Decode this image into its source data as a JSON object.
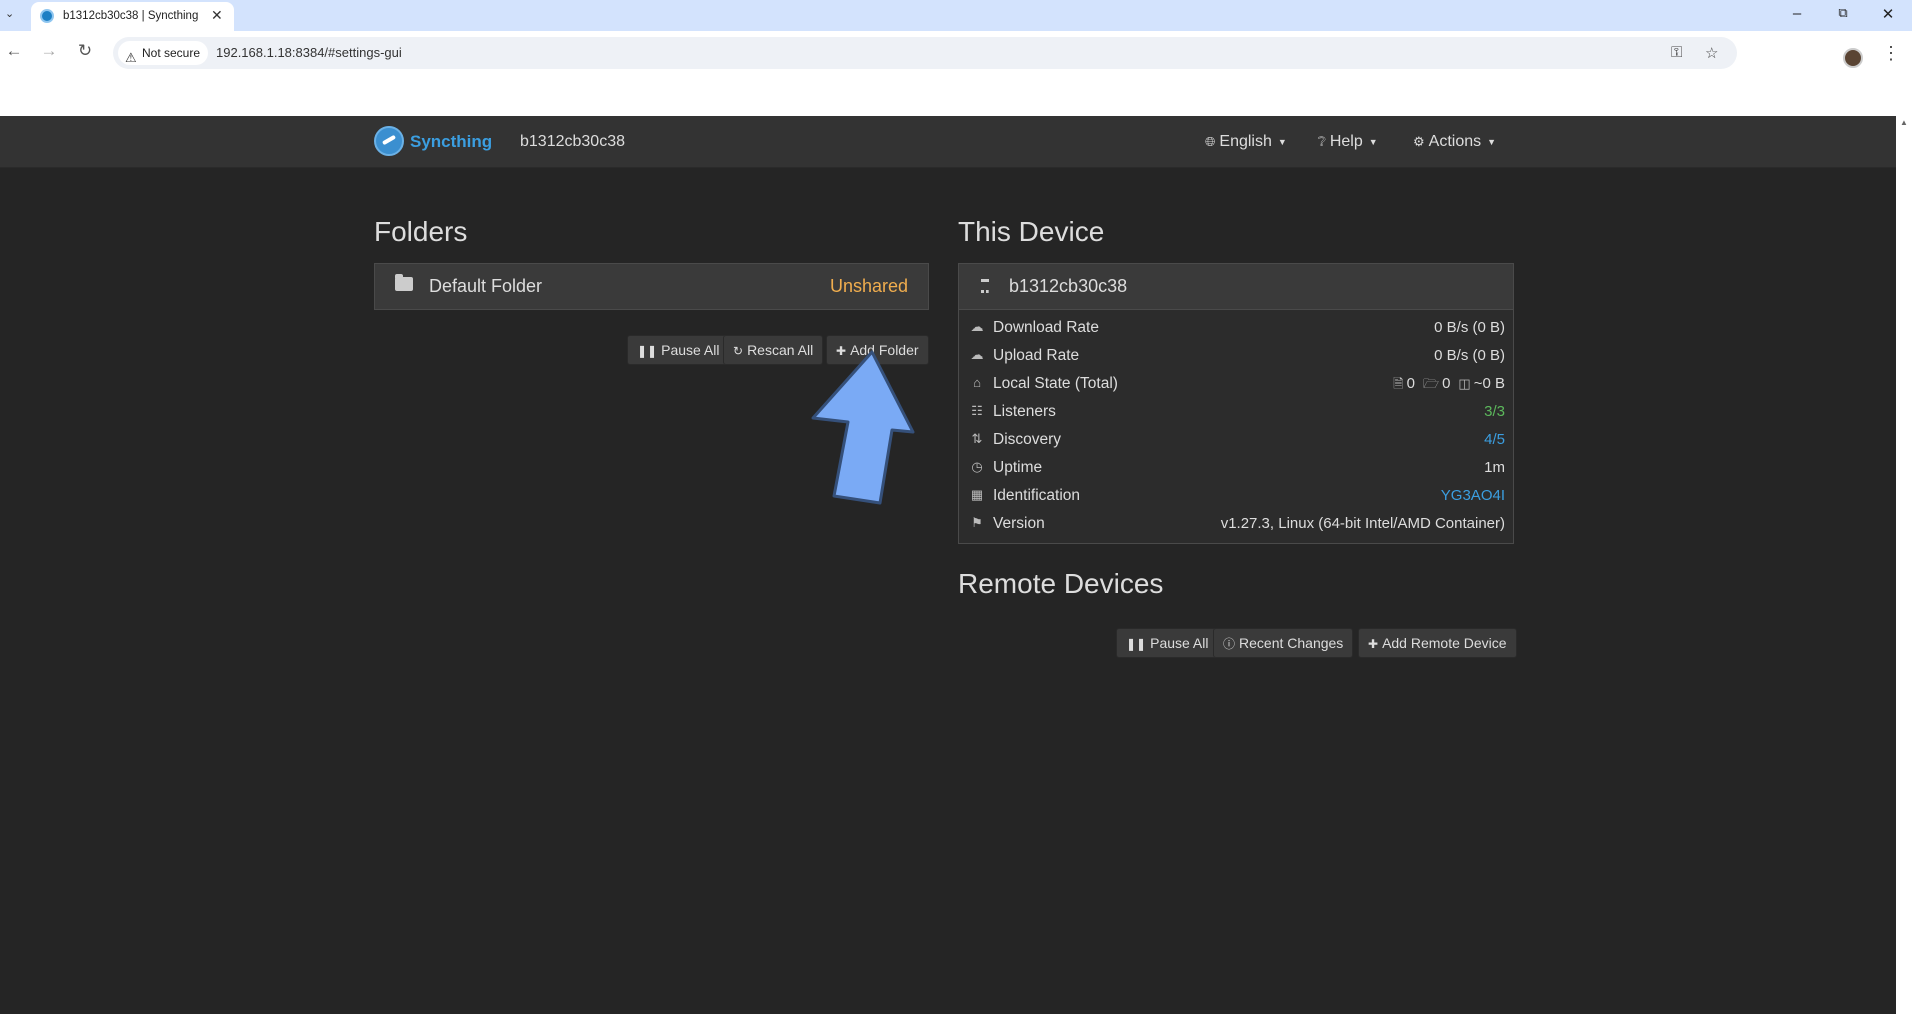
{
  "browser": {
    "tab_title": "b1312cb30c38 | Syncthing",
    "tab_close": "✕",
    "not_secure": "Not secure",
    "url": "192.168.1.18:8384/#settings-gui"
  },
  "app": {
    "brand": "Syncthing",
    "device_name": "b1312cb30c38",
    "menus": {
      "language": "English",
      "help": "Help",
      "actions": "Actions"
    }
  },
  "folders": {
    "title": "Folders",
    "items": [
      {
        "label": "Default Folder",
        "status": "Unshared"
      }
    ],
    "buttons": {
      "pause_all": "Pause All",
      "rescan_all": "Rescan All",
      "add_folder": "Add Folder"
    }
  },
  "this_device": {
    "title": "This Device",
    "name": "b1312cb30c38",
    "stats": [
      {
        "icon": "cloud-download-icon",
        "label": "Download Rate",
        "value": "0 B/s (0 B)"
      },
      {
        "icon": "cloud-upload-icon",
        "label": "Upload Rate",
        "value": "0 B/s (0 B)"
      },
      {
        "icon": "home-icon",
        "label": "Local State (Total)",
        "files": "0",
        "dirs": "0",
        "size": "~0 B"
      },
      {
        "icon": "sitemap-icon",
        "label": "Listeners",
        "value": "3/3",
        "color": "#5cb85c"
      },
      {
        "icon": "signpost-icon",
        "label": "Discovery",
        "value": "4/5",
        "color": "#3b9ee0"
      },
      {
        "icon": "clock-icon",
        "label": "Uptime",
        "value": "1m"
      },
      {
        "icon": "qrcode-icon",
        "label": "Identification",
        "value": "YG3AO4I",
        "color": "#3b9ee0"
      },
      {
        "icon": "tag-icon",
        "label": "Version",
        "value": "v1.27.3, Linux (64-bit Intel/AMD Container)"
      }
    ]
  },
  "remote_devices": {
    "title": "Remote Devices",
    "buttons": {
      "pause_all": "Pause All",
      "recent_changes": "Recent Changes",
      "add_remote_device": "Add Remote Device"
    }
  },
  "colors": {
    "background": "#252525",
    "navbar": "#333333",
    "accent": "#3b9ee0",
    "warning": "#f0ad4e",
    "success": "#5cb85c",
    "callout_arrow": "#7aaaf5"
  }
}
